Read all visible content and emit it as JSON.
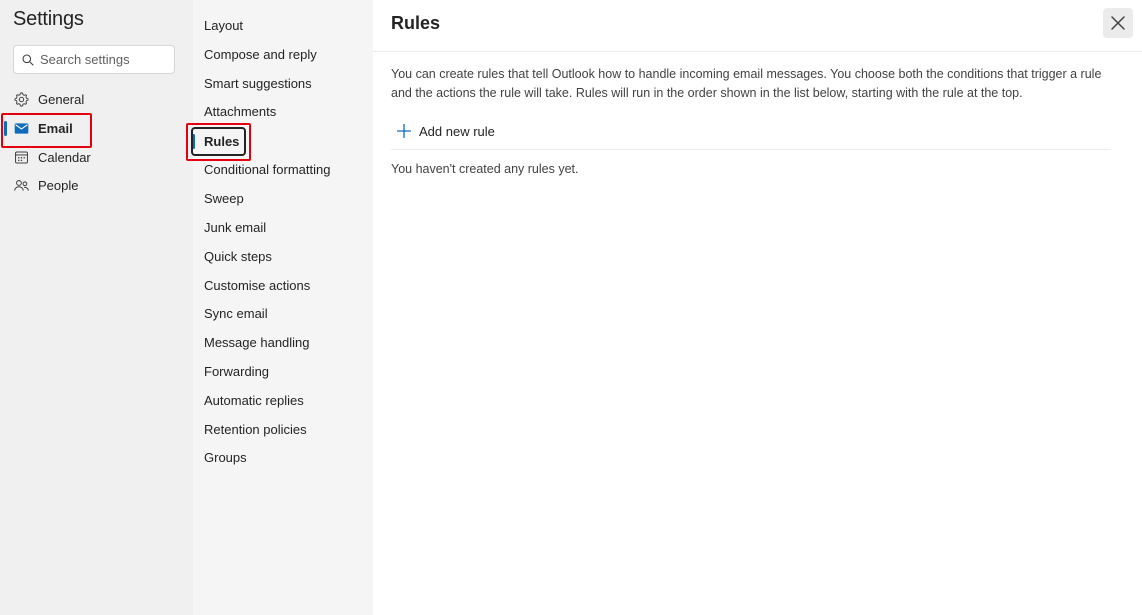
{
  "settings": {
    "title": "Settings",
    "search_placeholder": "Search settings",
    "categories": [
      {
        "label": "General",
        "icon": "gear-icon"
      },
      {
        "label": "Email",
        "icon": "mail-icon",
        "active": true
      },
      {
        "label": "Calendar",
        "icon": "calendar-icon"
      },
      {
        "label": "People",
        "icon": "people-icon"
      }
    ]
  },
  "sub_settings": {
    "items": [
      {
        "label": "Layout"
      },
      {
        "label": "Compose and reply"
      },
      {
        "label": "Smart suggestions"
      },
      {
        "label": "Attachments"
      },
      {
        "label": "Rules",
        "active": true
      },
      {
        "label": "Conditional formatting"
      },
      {
        "label": "Sweep"
      },
      {
        "label": "Junk email"
      },
      {
        "label": "Quick steps"
      },
      {
        "label": "Customise actions"
      },
      {
        "label": "Sync email"
      },
      {
        "label": "Message handling"
      },
      {
        "label": "Forwarding"
      },
      {
        "label": "Automatic replies"
      },
      {
        "label": "Retention policies"
      },
      {
        "label": "Groups"
      }
    ]
  },
  "main": {
    "title": "Rules",
    "description": "You can create rules that tell Outlook how to handle incoming email messages. You choose both the conditions that trigger a rule and the actions the rule will take. Rules will run in the order shown in the list below, starting with the rule at the top.",
    "add_rule_label": "Add new rule",
    "empty_message": "You haven't created any rules yet."
  },
  "colors": {
    "accent": "#0f6cbd",
    "highlight": "#e3000f"
  }
}
